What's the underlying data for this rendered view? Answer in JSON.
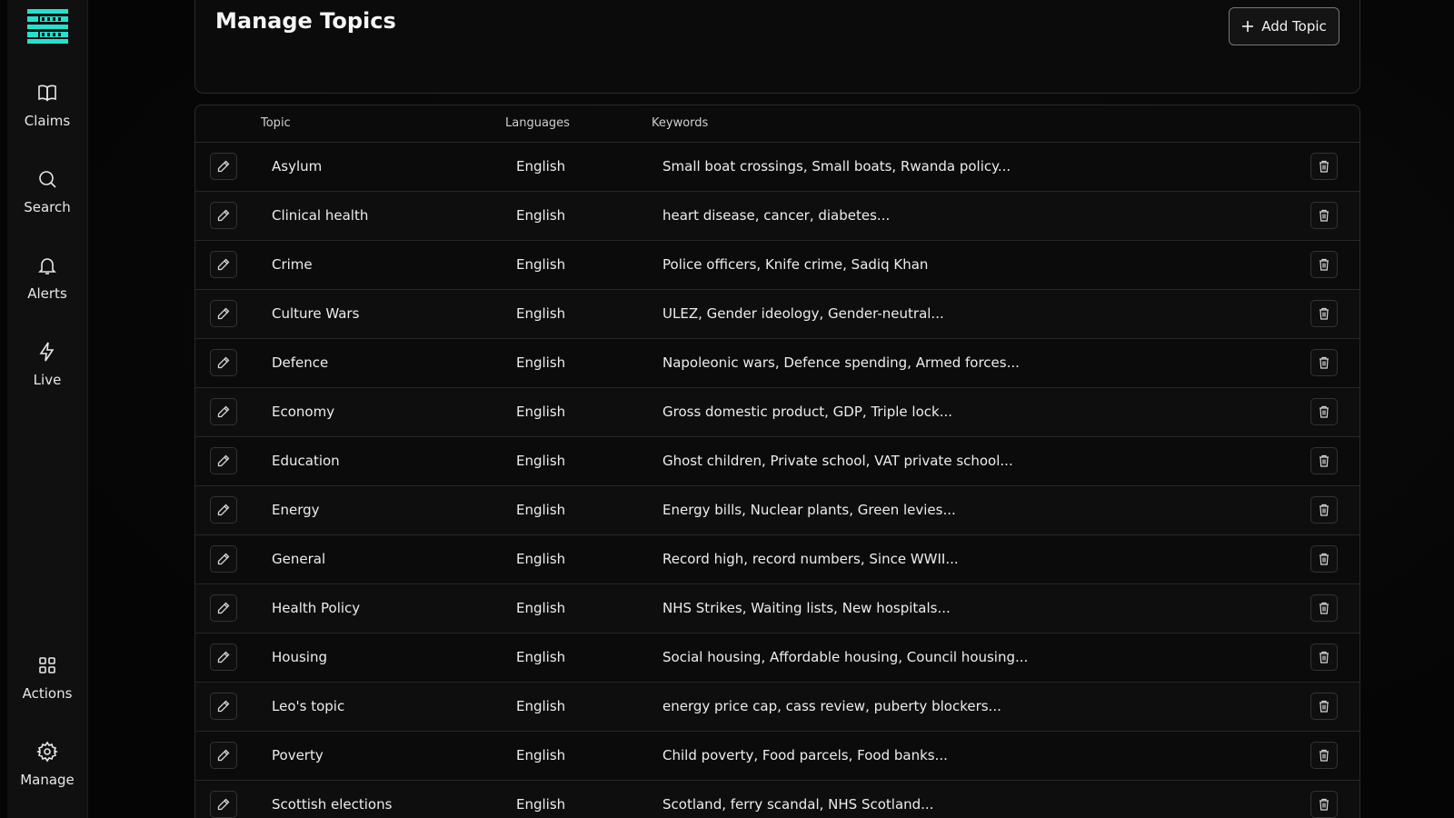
{
  "app": {
    "logo_text": "FULL FACT"
  },
  "sidebar": {
    "items": [
      {
        "label": "Claims",
        "icon": "book-icon"
      },
      {
        "label": "Search",
        "icon": "search-icon"
      },
      {
        "label": "Alerts",
        "icon": "bell-icon"
      },
      {
        "label": "Live",
        "icon": "lightning-icon"
      },
      {
        "label": "Actions",
        "icon": "grid-icon"
      },
      {
        "label": "Manage",
        "icon": "gear-icon"
      }
    ]
  },
  "header": {
    "title": "Manage Topics",
    "add_button_label": "Add Topic"
  },
  "table": {
    "columns": {
      "topic": "Topic",
      "languages": "Languages",
      "keywords": "Keywords"
    },
    "rows": [
      {
        "topic": "Asylum",
        "language": "English",
        "keywords": "Small boat crossings, Small boats, Rwanda policy..."
      },
      {
        "topic": "Clinical health",
        "language": "English",
        "keywords": "heart disease, cancer, diabetes..."
      },
      {
        "topic": "Crime",
        "language": "English",
        "keywords": "Police officers, Knife crime, Sadiq Khan"
      },
      {
        "topic": "Culture Wars",
        "language": "English",
        "keywords": "ULEZ, Gender ideology, Gender-neutral..."
      },
      {
        "topic": "Defence",
        "language": "English",
        "keywords": "Napoleonic wars, Defence spending, Armed forces..."
      },
      {
        "topic": "Economy",
        "language": "English",
        "keywords": "Gross domestic product, GDP, Triple lock..."
      },
      {
        "topic": "Education",
        "language": "English",
        "keywords": "Ghost children, Private school, VAT private school..."
      },
      {
        "topic": "Energy",
        "language": "English",
        "keywords": "Energy bills, Nuclear plants, Green levies..."
      },
      {
        "topic": "General",
        "language": "English",
        "keywords": "Record high, record numbers, Since WWII..."
      },
      {
        "topic": "Health Policy",
        "language": "English",
        "keywords": "NHS Strikes, Waiting lists, New hospitals..."
      },
      {
        "topic": "Housing",
        "language": "English",
        "keywords": "Social housing, Affordable housing, Council housing..."
      },
      {
        "topic": "Leo's topic",
        "language": "English",
        "keywords": "energy price cap, cass review, puberty blockers..."
      },
      {
        "topic": "Poverty",
        "language": "English",
        "keywords": "Child poverty, Food parcels, Food banks..."
      },
      {
        "topic": "Scottish elections",
        "language": "English",
        "keywords": "Scotland, ferry scandal, NHS Scotland..."
      }
    ]
  },
  "colors": {
    "accent": "#1ee3cf",
    "background": "#050505",
    "panel": "#0b0b0b"
  }
}
